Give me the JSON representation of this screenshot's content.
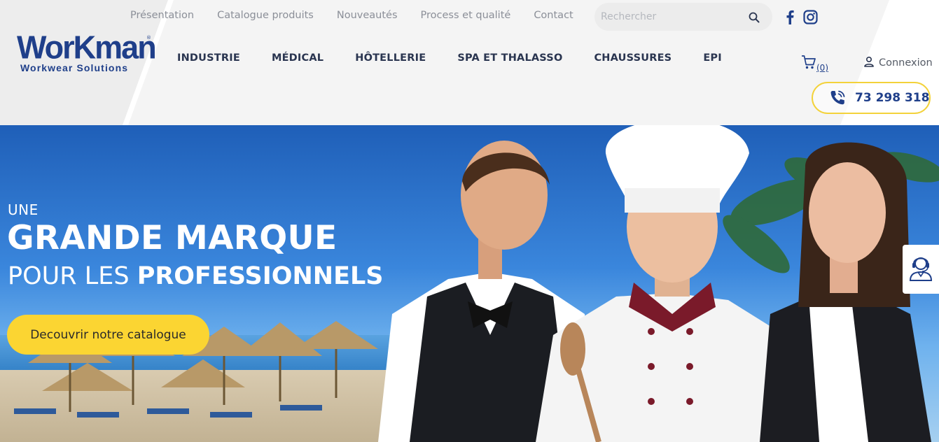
{
  "brand": {
    "logo_main": "WorKman",
    "logo_reg": "®",
    "logo_sub": "Workwear Solutions",
    "primary_color": "#1f3f8a",
    "accent_color": "#fbd532"
  },
  "topnav": {
    "items": [
      {
        "label": "Présentation"
      },
      {
        "label": "Catalogue produits"
      },
      {
        "label": "Nouveautés"
      },
      {
        "label": "Process et qualité"
      },
      {
        "label": "Contact"
      }
    ]
  },
  "search": {
    "placeholder": "Rechercher",
    "value": "",
    "icon": "search-icon"
  },
  "social": {
    "facebook_icon": "facebook-icon",
    "instagram_icon": "instagram-icon"
  },
  "mainnav": {
    "items": [
      {
        "label": "INDUSTRIE"
      },
      {
        "label": "MÉDICAL"
      },
      {
        "label": "HÔTELLERIE"
      },
      {
        "label": "SPA ET THALASSO"
      },
      {
        "label": "CHAUSSURES"
      },
      {
        "label": "EPI"
      }
    ]
  },
  "cart": {
    "icon": "cart-icon",
    "count_text": "(0)"
  },
  "account": {
    "icon": "user-icon",
    "label": "Connexion"
  },
  "phone": {
    "icon": "phone-icon",
    "number": "73 298 318"
  },
  "hero": {
    "line1": "UNE",
    "line2": "GRANDE MARQUE",
    "line3_light": "POUR LES ",
    "line3_bold": "PROFESSIONNELS",
    "cta_label": "Decouvrir notre catalogue"
  },
  "support_widget": {
    "icon": "support-agent-icon"
  }
}
